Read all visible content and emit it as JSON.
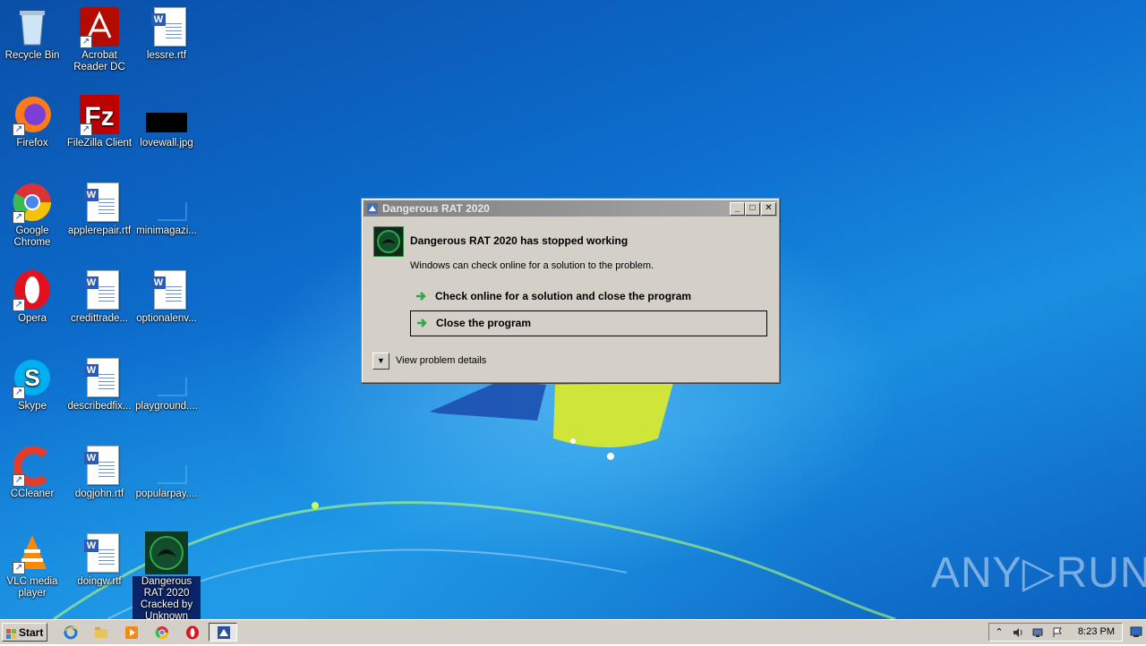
{
  "desktop": {
    "icons": [
      {
        "label": "Recycle Bin",
        "icon": "recycle-bin-icon"
      },
      {
        "label": "Acrobat Reader DC",
        "icon": "acrobat-icon"
      },
      {
        "label": "lessre.rtf",
        "icon": "word-document-icon"
      },
      {
        "label": "Firefox",
        "icon": "firefox-icon"
      },
      {
        "label": "FileZilla Client",
        "icon": "filezilla-icon"
      },
      {
        "label": "lovewall.jpg",
        "icon": "image-file-icon"
      },
      {
        "label": "Google Chrome",
        "icon": "chrome-icon"
      },
      {
        "label": "applerepair.rtf",
        "icon": "word-document-icon"
      },
      {
        "label": "minimagazi...",
        "icon": "blank-file-icon"
      },
      {
        "label": "Opera",
        "icon": "opera-icon"
      },
      {
        "label": "credittrade...",
        "icon": "word-document-icon"
      },
      {
        "label": "optionalenv...",
        "icon": "word-document-icon"
      },
      {
        "label": "Skype",
        "icon": "skype-icon"
      },
      {
        "label": "describedfix...",
        "icon": "word-document-icon"
      },
      {
        "label": "playground....",
        "icon": "blank-file-icon"
      },
      {
        "label": "CCleaner",
        "icon": "ccleaner-icon"
      },
      {
        "label": "dogjohn.rtf",
        "icon": "word-document-icon"
      },
      {
        "label": "popularpay....",
        "icon": "blank-file-icon"
      },
      {
        "label": "VLC media player",
        "icon": "vlc-icon"
      },
      {
        "label": "doingw.rtf",
        "icon": "word-document-icon"
      },
      {
        "label": "Dangerous RAT 2020 Cracked by Unknown",
        "icon": "dangerous-rat-icon"
      }
    ],
    "watermark": "ANY▷RUN"
  },
  "dialog": {
    "title": "Dangerous RAT 2020",
    "heading": "Dangerous RAT 2020 has stopped working",
    "subtext": "Windows can check online for a solution to the problem.",
    "option_check": "Check online for a solution and close the program",
    "option_close": "Close the program",
    "details": "View problem details",
    "min_label": "_",
    "max_label": "□",
    "close_label": "✕",
    "accent": "#2ea84a"
  },
  "taskbar": {
    "start_label": "Start",
    "clock": "8:23 PM",
    "quicklaunch": [
      "ie-icon",
      "explorer-icon",
      "media-player-icon",
      "chrome-icon",
      "opera-icon"
    ],
    "tray": [
      "chevron-up-icon",
      "speaker-icon",
      "network-icon",
      "flag-icon"
    ]
  }
}
